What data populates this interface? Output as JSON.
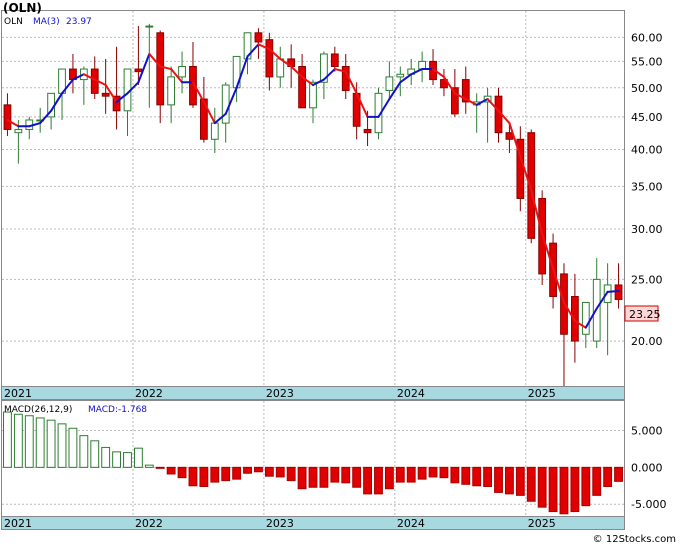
{
  "title": "(OLN)",
  "watermark": "© 12Stocks.com",
  "price_panel": {
    "legend_symbol": "OLN",
    "legend_ma_label": "MA(3)",
    "legend_ma_value": "23.97",
    "last_price_label": "23.25",
    "y_ticks": [
      "60.00",
      "55.00",
      "50.00",
      "45.00",
      "40.00",
      "35.00",
      "30.00",
      "25.00",
      "20.00"
    ]
  },
  "macd_panel": {
    "legend_label": "MACD(26,12,9)",
    "legend_value": "MACD:-1.768",
    "y_ticks": [
      "5.000",
      "0.000",
      "-5.000"
    ]
  },
  "x_labels": [
    "2021",
    "2022",
    "2023",
    "2024",
    "2025"
  ],
  "colors": {
    "up": "#2e7d32",
    "down": "#e00000",
    "ma_up": "#1111cc",
    "ma_down": "#ee1111",
    "axis_band": "#a8d8e0",
    "grid": "#bbbbbb",
    "price_badge": "#ffd6d6"
  },
  "chart_data": [
    {
      "type": "candlestick",
      "scale": "log",
      "ylim": [
        17,
        66
      ],
      "x": [
        "2021-01",
        "2021-02",
        "2021-03",
        "2021-04",
        "2021-05",
        "2021-06",
        "2021-07",
        "2021-08",
        "2021-09",
        "2021-10",
        "2021-11",
        "2021-12",
        "2022-01",
        "2022-02",
        "2022-03",
        "2022-04",
        "2022-05",
        "2022-06",
        "2022-07",
        "2022-08",
        "2022-09",
        "2022-10",
        "2022-11",
        "2022-12",
        "2023-01",
        "2023-02",
        "2023-03",
        "2023-04",
        "2023-05",
        "2023-06",
        "2023-07",
        "2023-08",
        "2023-09",
        "2023-10",
        "2023-11",
        "2023-12",
        "2024-01",
        "2024-02",
        "2024-03",
        "2024-04",
        "2024-05",
        "2024-06",
        "2024-07",
        "2024-08",
        "2024-09",
        "2024-10",
        "2024-11",
        "2024-12",
        "2025-01",
        "2025-02",
        "2025-03",
        "2025-04",
        "2025-05",
        "2025-06",
        "2025-07",
        "2025-08",
        "2025-09"
      ],
      "open": [
        47.0,
        42.5,
        43.0,
        44.5,
        45.0,
        49.0,
        53.5,
        51.5,
        53.5,
        49.0,
        48.5,
        46.0,
        53.5,
        62.5,
        61.0,
        47.0,
        52.0,
        54.0,
        48.0,
        41.5,
        44.0,
        50.0,
        55.5,
        61.0,
        59.5,
        52.0,
        55.5,
        54.0,
        46.5,
        51.0,
        56.5,
        54.0,
        49.0,
        43.0,
        42.5,
        49.5,
        52.0,
        52.5,
        53.5,
        55.0,
        51.5,
        50.0,
        51.5,
        47.0,
        47.5,
        48.5,
        42.5,
        41.5,
        42.5,
        33.5,
        28.5,
        25.5,
        23.5,
        20.5,
        20.0,
        23.0,
        24.5
      ],
      "high": [
        49.0,
        44.5,
        45.0,
        46.5,
        48.0,
        52.0,
        56.5,
        54.0,
        56.0,
        55.5,
        58.0,
        53.5,
        62.5,
        63.0,
        61.5,
        54.0,
        57.0,
        59.0,
        52.0,
        46.5,
        51.0,
        55.5,
        59.0,
        62.0,
        61.0,
        58.0,
        58.5,
        56.5,
        51.5,
        57.0,
        58.0,
        56.5,
        51.0,
        46.0,
        50.0,
        55.0,
        54.0,
        55.5,
        57.0,
        57.5,
        53.5,
        53.5,
        54.0,
        49.0,
        50.0,
        50.0,
        44.0,
        43.5,
        43.0,
        34.5,
        29.5,
        26.5,
        25.5,
        23.0,
        27.0,
        26.5,
        26.5
      ],
      "low": [
        42.0,
        38.0,
        41.5,
        42.5,
        43.0,
        44.5,
        49.0,
        47.0,
        48.0,
        45.5,
        43.0,
        42.0,
        50.5,
        46.5,
        44.0,
        44.0,
        49.0,
        46.5,
        41.0,
        39.5,
        41.0,
        47.5,
        52.5,
        55.5,
        49.5,
        50.0,
        50.0,
        46.5,
        44.0,
        48.0,
        53.0,
        48.0,
        41.5,
        40.5,
        41.5,
        48.0,
        48.5,
        50.5,
        51.0,
        50.5,
        48.5,
        45.0,
        45.5,
        42.5,
        41.0,
        41.0,
        39.5,
        32.0,
        28.5,
        24.5,
        22.5,
        17.0,
        18.5,
        19.5,
        19.5,
        19.0,
        22.5
      ],
      "close": [
        43.0,
        43.0,
        44.5,
        44.5,
        49.0,
        53.5,
        51.5,
        53.5,
        49.0,
        48.5,
        46.0,
        53.5,
        53.0,
        62.5,
        47.0,
        52.0,
        54.0,
        47.0,
        41.5,
        44.0,
        50.5,
        56.0,
        61.0,
        59.0,
        52.0,
        55.5,
        54.0,
        46.5,
        51.0,
        56.5,
        54.0,
        49.5,
        43.5,
        42.5,
        49.0,
        52.0,
        52.5,
        53.5,
        55.0,
        51.5,
        50.0,
        45.5,
        47.5,
        47.5,
        48.5,
        42.5,
        41.5,
        33.5,
        29.0,
        25.5,
        23.5,
        20.5,
        20.0,
        23.0,
        25.0,
        24.5,
        23.25
      ],
      "ma3": [
        44.5,
        43.5,
        43.5,
        44.0,
        46.0,
        49.0,
        51.5,
        52.5,
        51.5,
        50.5,
        47.5,
        49.0,
        51.0,
        56.5,
        54.0,
        53.5,
        51.0,
        51.0,
        47.5,
        44.0,
        45.5,
        50.0,
        56.0,
        58.5,
        57.5,
        55.5,
        54.0,
        52.0,
        50.5,
        51.5,
        53.5,
        53.0,
        49.0,
        45.0,
        45.0,
        48.0,
        51.0,
        52.5,
        53.5,
        53.5,
        52.0,
        49.0,
        48.0,
        47.0,
        48.0,
        46.0,
        44.0,
        39.0,
        34.5,
        29.5,
        26.0,
        23.0,
        21.5,
        21.0,
        22.5,
        23.9,
        23.97
      ]
    },
    {
      "type": "bar",
      "title": "MACD(26,12,9)",
      "ylim": [
        -6.6,
        9.0
      ],
      "values": [
        7.5,
        7.2,
        7.0,
        6.7,
        6.4,
        5.9,
        5.3,
        4.3,
        3.6,
        2.7,
        2.1,
        2.0,
        2.6,
        0.3,
        -0.1,
        -0.9,
        -1.4,
        -2.5,
        -2.6,
        -2.0,
        -1.8,
        -1.6,
        -0.8,
        -0.6,
        -1.2,
        -1.3,
        -1.8,
        -2.9,
        -2.7,
        -2.7,
        -2.0,
        -2.1,
        -2.7,
        -3.6,
        -3.6,
        -2.9,
        -2.0,
        -2.0,
        -1.6,
        -1.3,
        -1.4,
        -2.1,
        -2.3,
        -2.5,
        -2.6,
        -3.4,
        -3.6,
        -3.8,
        -4.6,
        -5.4,
        -6.0,
        -6.3,
        -6.0,
        -5.2,
        -3.8,
        -2.6,
        -1.9
      ]
    }
  ]
}
